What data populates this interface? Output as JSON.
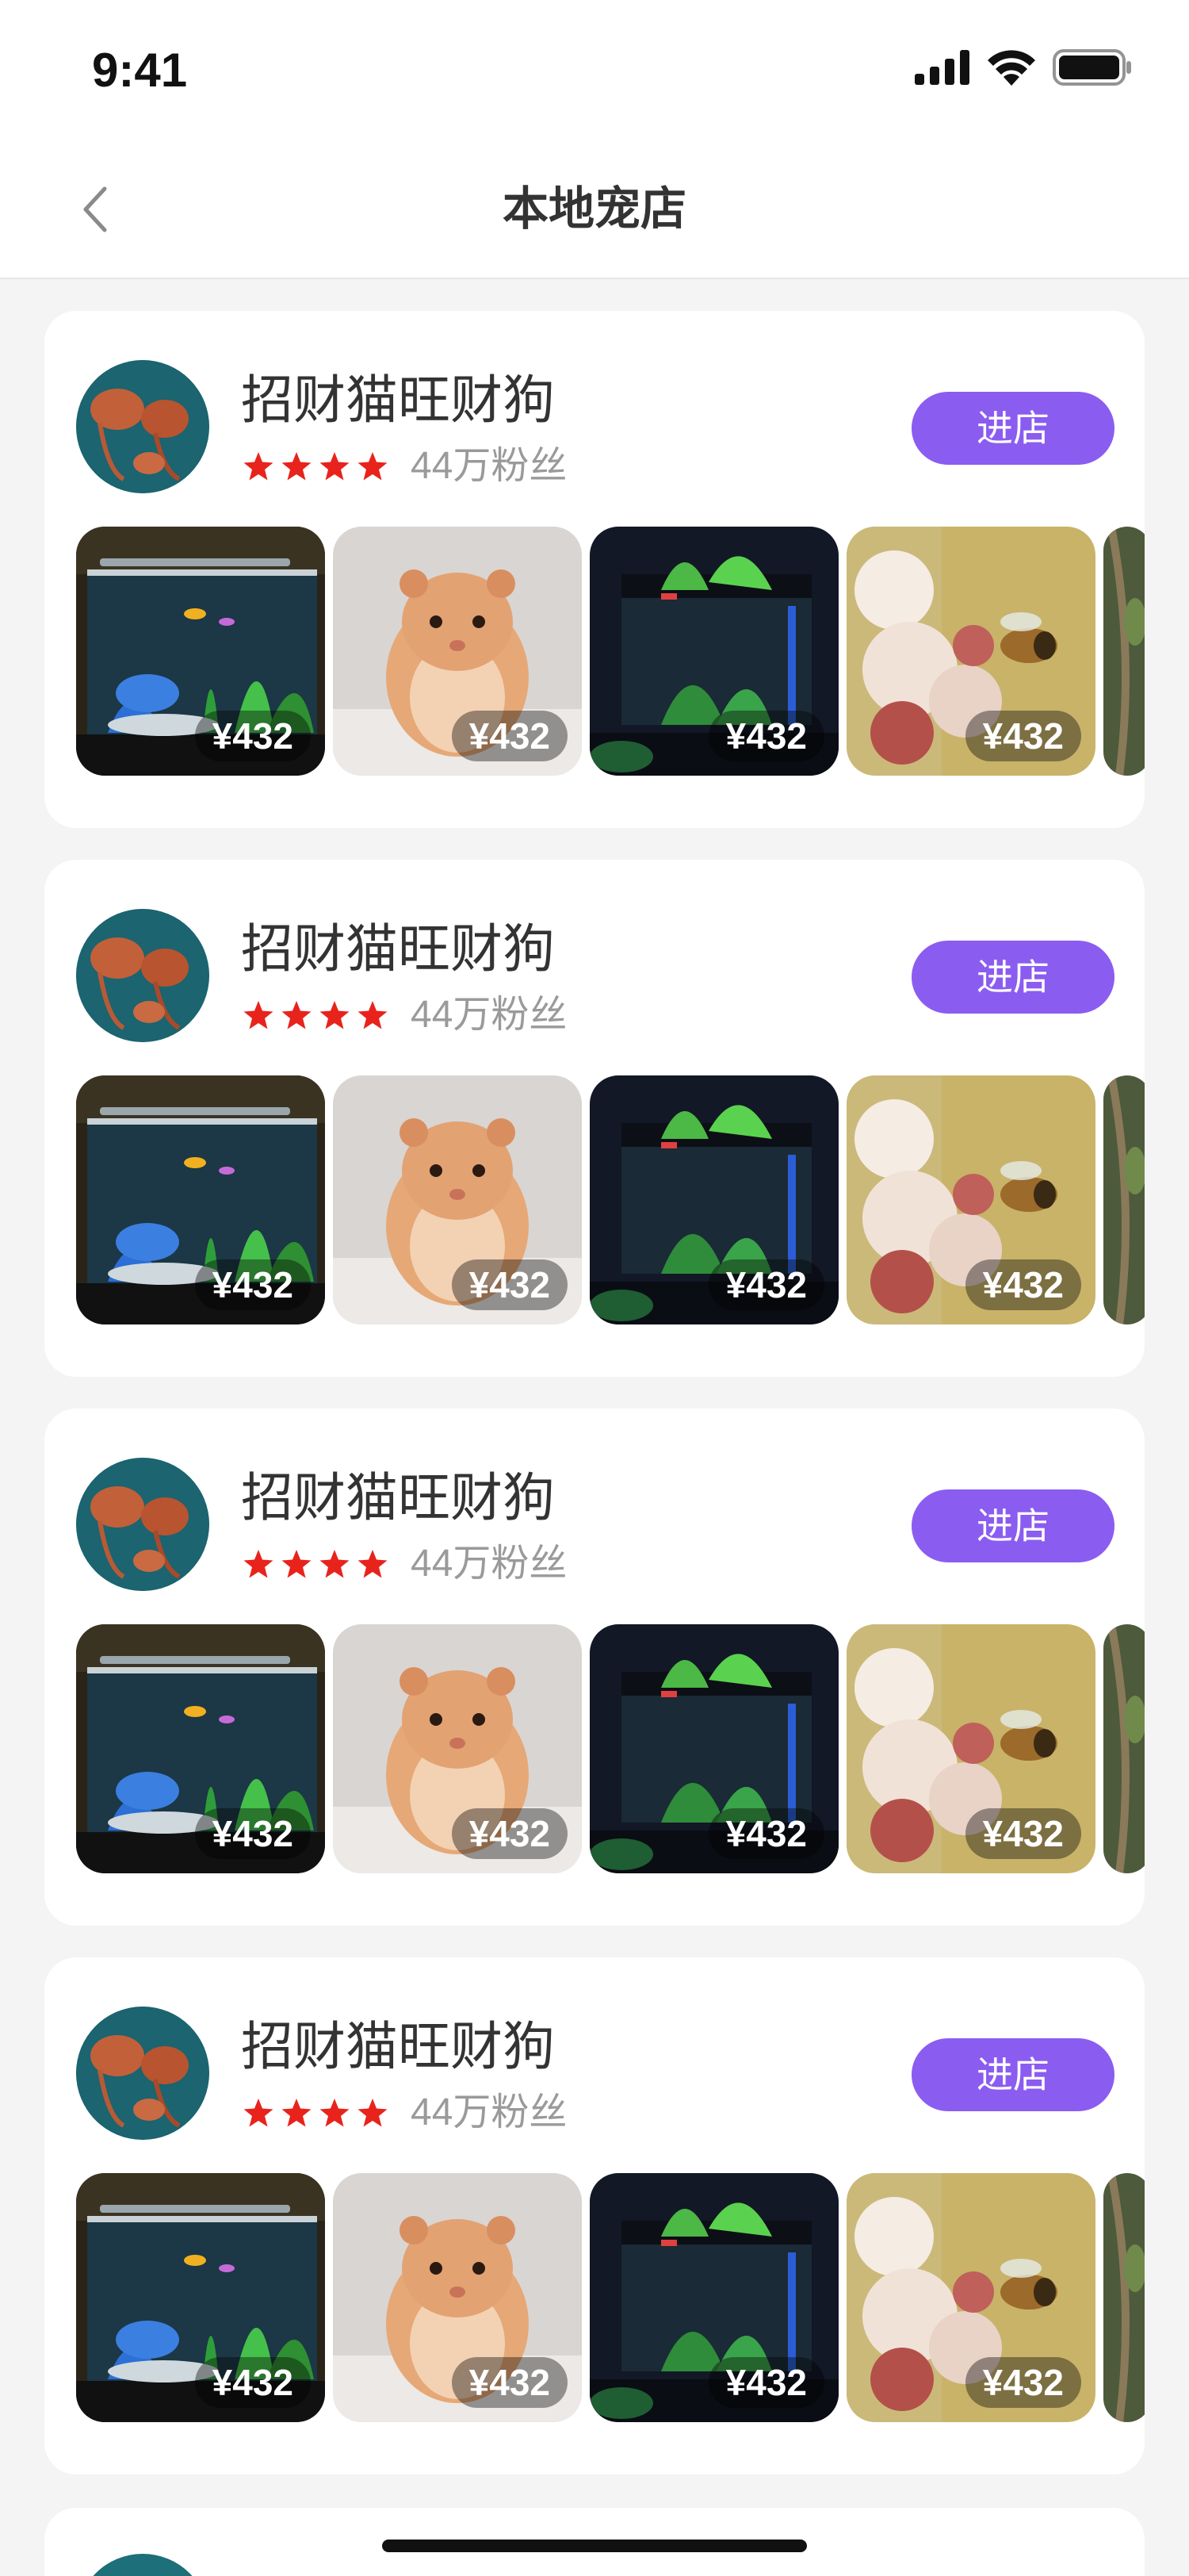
{
  "status_bar": {
    "time": "9:41"
  },
  "nav": {
    "title": "本地宠店",
    "back_icon": "chevron-left-icon"
  },
  "colors": {
    "accent": "#8b5cf0",
    "star": "#e8231c",
    "muted": "#9a9a9a"
  },
  "shops": [
    {
      "name": "招财猫旺财狗",
      "rating": 4,
      "fans": "44万粉丝",
      "enter_label": "进店",
      "products": [
        {
          "kind": "aquarium",
          "price": "¥432"
        },
        {
          "kind": "hamster",
          "price": "¥432"
        },
        {
          "kind": "fish-tank",
          "price": "¥432"
        },
        {
          "kind": "bee-flower",
          "price": "¥432"
        }
      ]
    },
    {
      "name": "招财猫旺财狗",
      "rating": 4,
      "fans": "44万粉丝",
      "enter_label": "进店",
      "products": [
        {
          "kind": "aquarium",
          "price": "¥432"
        },
        {
          "kind": "hamster",
          "price": "¥432"
        },
        {
          "kind": "fish-tank",
          "price": "¥432"
        },
        {
          "kind": "bee-flower",
          "price": "¥432"
        }
      ]
    },
    {
      "name": "招财猫旺财狗",
      "rating": 4,
      "fans": "44万粉丝",
      "enter_label": "进店",
      "products": [
        {
          "kind": "aquarium",
          "price": "¥432"
        },
        {
          "kind": "hamster",
          "price": "¥432"
        },
        {
          "kind": "fish-tank",
          "price": "¥432"
        },
        {
          "kind": "bee-flower",
          "price": "¥432"
        }
      ]
    },
    {
      "name": "招财猫旺财狗",
      "rating": 4,
      "fans": "44万粉丝",
      "enter_label": "进店",
      "products": [
        {
          "kind": "aquarium",
          "price": "¥432"
        },
        {
          "kind": "hamster",
          "price": "¥432"
        },
        {
          "kind": "fish-tank",
          "price": "¥432"
        },
        {
          "kind": "bee-flower",
          "price": "¥432"
        }
      ]
    }
  ]
}
